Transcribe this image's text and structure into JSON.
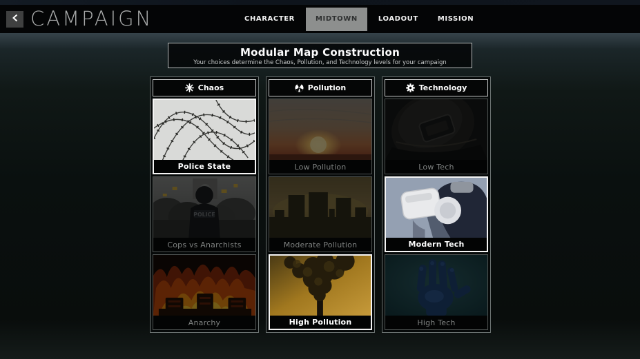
{
  "topbar": {
    "title": "CAMPAIGN",
    "tabs": [
      {
        "label": "CHARACTER",
        "selected": false
      },
      {
        "label": "MIDTOWN",
        "selected": true
      },
      {
        "label": "LOADOUT",
        "selected": false
      },
      {
        "label": "MISSION",
        "selected": false
      }
    ]
  },
  "header": {
    "title": "Modular Map Construction",
    "subtitle": "Your choices determine the Chaos, Pollution, and Technology levels for your campaign"
  },
  "columns": [
    {
      "label": "Chaos",
      "icon": "starburst-icon",
      "items": [
        {
          "label": "Police State",
          "selected": true,
          "image": "barbed-wire"
        },
        {
          "label": "Cops vs Anarchists",
          "selected": false,
          "image": "riot-police",
          "image_text": "POLICE"
        },
        {
          "label": "Anarchy",
          "selected": false,
          "image": "burning-fire"
        }
      ]
    },
    {
      "label": "Pollution",
      "icon": "radiation-icon",
      "items": [
        {
          "label": "Low Pollution",
          "selected": false,
          "image": "hazy-sunset"
        },
        {
          "label": "Moderate Pollution",
          "selected": false,
          "image": "smog-skyline"
        },
        {
          "label": "High Pollution",
          "selected": true,
          "image": "smokestack"
        }
      ]
    },
    {
      "label": "Technology",
      "icon": "gear-icon",
      "items": [
        {
          "label": "Low Tech",
          "selected": false,
          "image": "old-helmet"
        },
        {
          "label": "Modern Tech",
          "selected": true,
          "image": "vr-headset"
        },
        {
          "label": "High Tech",
          "selected": false,
          "image": "robotic-hand"
        }
      ]
    }
  ],
  "colors": {
    "topbar_bg": "#040506",
    "selected_tab_bg": "#8d8f8e",
    "selected_border": "#f4f4f4",
    "unselected_label": "#7f8281",
    "panel_border": "#6d7473"
  }
}
